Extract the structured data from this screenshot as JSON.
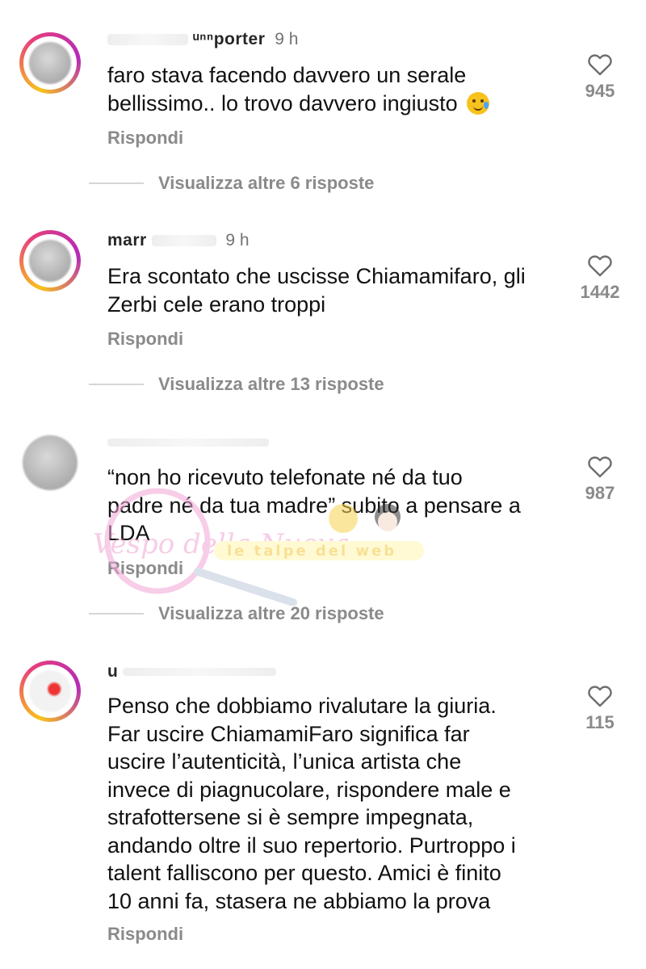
{
  "comments": [
    {
      "username": "ᵘⁿⁿporter",
      "time": "9 h",
      "text_lines": [
        "faro stava facendo davvero un serale",
        "bellissimo.. lo trovo davvero ingiusto"
      ],
      "emoji": "crying-smile-emoji",
      "reply_label": "Rispondi",
      "view_more": "Visualizza altre 6 risposte",
      "likes": "945"
    },
    {
      "username": "marr",
      "time": "9 h",
      "text_lines": [
        "Era scontato che uscisse Chiamamifaro, gli",
        "Zerbi cele erano troppi"
      ],
      "reply_label": "Rispondi",
      "view_more": "Visualizza altre 13 risposte",
      "likes": "1442"
    },
    {
      "username": "",
      "time": "",
      "text_lines": [
        "“non ho ricevuto telefonate né da tuo",
        "padre né da tua madre” subito a pensare a",
        "LDA"
      ],
      "reply_label": "Rispondi",
      "view_more": "Visualizza altre 20 risposte",
      "likes": "987"
    },
    {
      "username": "u",
      "time": "",
      "text_lines": [
        "Penso che dobbiamo rivalutare la giuria.",
        "Far uscire ChiamamiFaro significa far",
        "uscire l’autenticità, l’unica artista che",
        "invece di piagnucolare, rispondere male e",
        "strafottersene si è sempre impegnata,",
        "andando oltre il suo repertorio. Purtroppo i",
        "talent falliscono per questo. Amici è finito",
        "10 anni fa, stasera ne abbiamo la prova"
      ],
      "reply_label": "Rispondi",
      "likes": "115"
    }
  ],
  "watermark": {
    "logo_text": "Vespo della Nuova",
    "banner_text": "le talpe del web"
  },
  "colors": {
    "text": "#111111",
    "secondary": "#8a8a8a",
    "story_ring": [
      "#f7c21d",
      "#e8407a",
      "#b42ab8"
    ]
  }
}
